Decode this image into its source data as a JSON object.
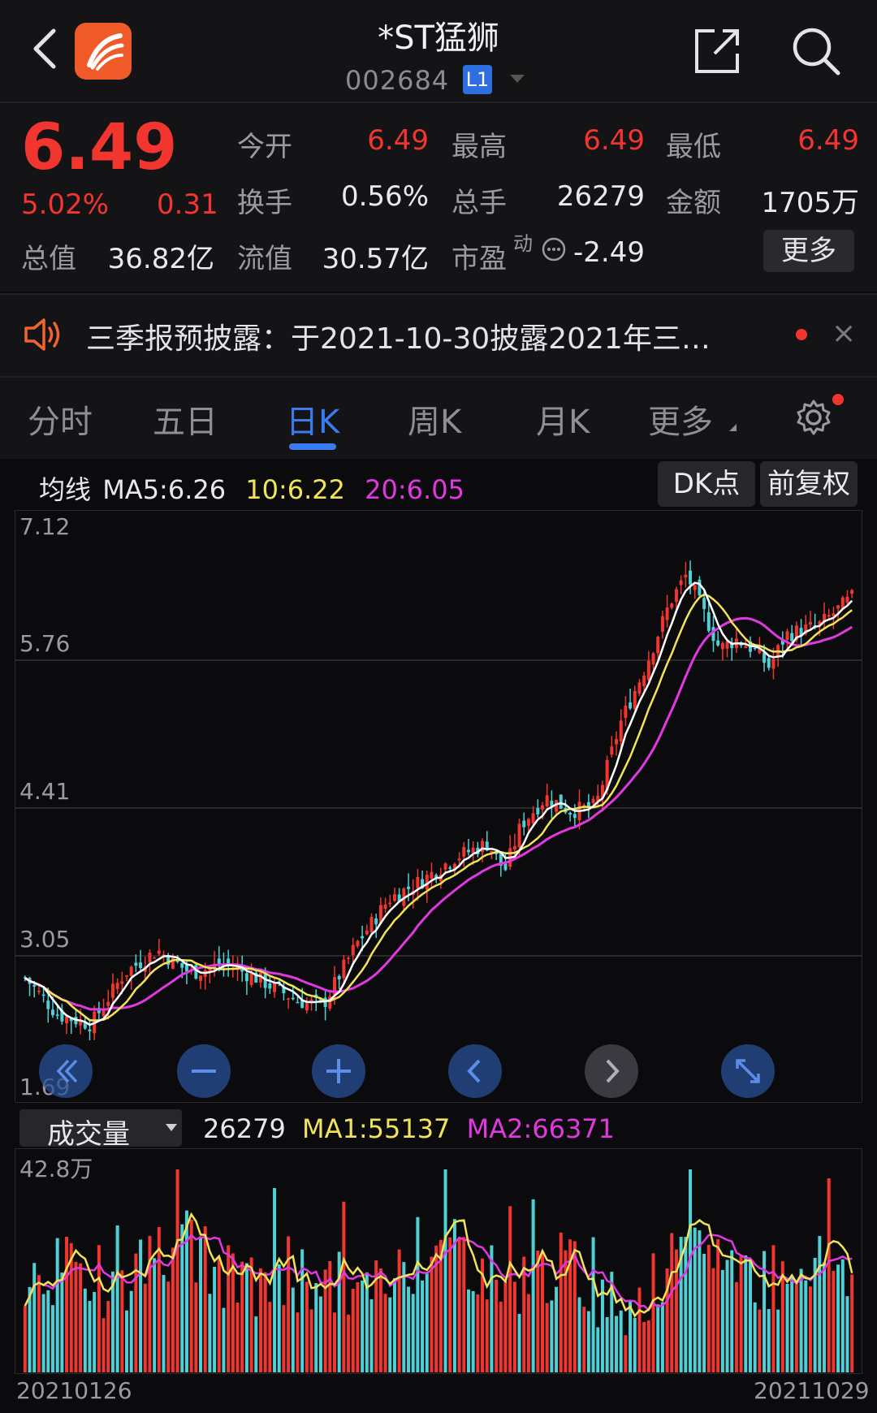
{
  "header": {
    "title": "*ST猛狮",
    "code": "002684",
    "level_badge": "L1"
  },
  "quote": {
    "price": "6.49",
    "change_pct": "5.02%",
    "change": "0.31",
    "open_label": "今开",
    "open": "6.49",
    "high_label": "最高",
    "high": "6.49",
    "low_label": "最低",
    "low": "6.49",
    "turnover_label": "换手",
    "turnover": "0.56%",
    "volume_label": "总手",
    "volume": "26279",
    "amount_label": "金额",
    "amount": "1705万",
    "mktcap_label": "总值",
    "mktcap": "36.82亿",
    "float_label": "流值",
    "float": "30.57亿",
    "pe_label": "市盈",
    "pe_sup": "动",
    "pe": "-2.49",
    "more_label": "更多"
  },
  "notice": {
    "text": "三季报预披露：于2021-10-30披露2021年三…",
    "close": "×"
  },
  "tabs": [
    {
      "label": "分时"
    },
    {
      "label": "五日"
    },
    {
      "label": "日K",
      "active": true
    },
    {
      "label": "周K"
    },
    {
      "label": "月K"
    },
    {
      "label": "更多"
    }
  ],
  "ma": {
    "label": "均线",
    "ma5": "MA5:6.26",
    "ma10": "10:6.22",
    "ma20": "20:6.05",
    "btn_dk": "DK点",
    "btn_adj": "前复权"
  },
  "kline": {
    "ylabels": [
      "7.12",
      "5.76",
      "4.41",
      "3.05",
      "1.69"
    ]
  },
  "volume": {
    "selector": "成交量",
    "value": "26279",
    "ma1": "MA1:55137",
    "ma2": "MA2:66371",
    "ymax_label": "42.8万",
    "date_start": "20210126",
    "date_end": "20211029"
  },
  "colors": {
    "up": "#f2352e",
    "down": "#4fd0d6",
    "ma5": "#ffffff",
    "ma10": "#f2e45a",
    "ma20": "#e238e2",
    "accent": "#3b7bf0"
  },
  "icons": {
    "back": "chevron-left-icon",
    "logo": "app-logo",
    "share": "share-icon",
    "search": "search-icon",
    "speaker": "speaker-icon",
    "settings": "gear-icon"
  }
}
